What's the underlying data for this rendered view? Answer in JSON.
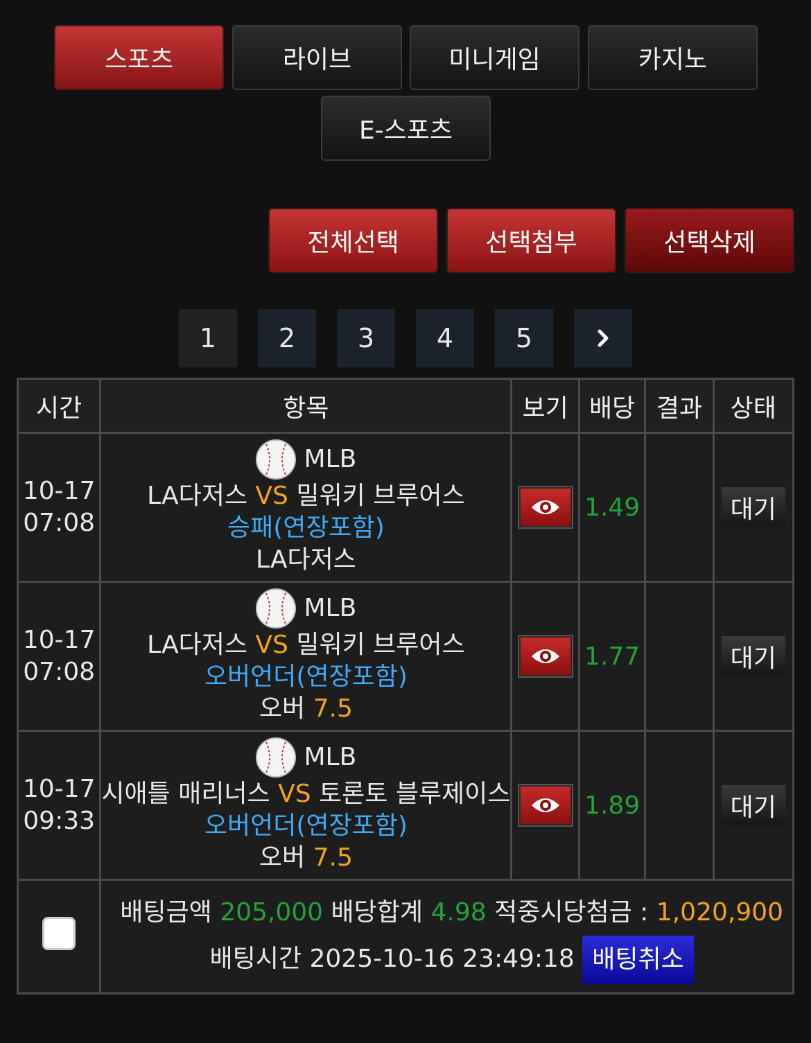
{
  "tabs": [
    {
      "label": "스포츠",
      "active": true
    },
    {
      "label": "라이브",
      "active": false
    },
    {
      "label": "미니게임",
      "active": false
    },
    {
      "label": "카지노",
      "active": false
    },
    {
      "label": "E-스포츠",
      "active": false
    }
  ],
  "actions": {
    "select_all": "전체선택",
    "attach_selected": "선택첨부",
    "delete_selected": "선택삭제"
  },
  "pagination": {
    "pages": [
      "1",
      "2",
      "3",
      "4",
      "5"
    ],
    "current": "1",
    "next_icon": "chevron-right-icon"
  },
  "table": {
    "headers": {
      "time": "시간",
      "item": "항목",
      "view": "보기",
      "odds": "배당",
      "result": "결과",
      "status": "상태"
    },
    "rows": [
      {
        "date": "10-17",
        "time": "07:08",
        "league": "MLB",
        "home": "LA다저스",
        "vs": "VS",
        "away": "밀워키 브루어스",
        "market": "승패(연장포함)",
        "pick": "LA다저스",
        "pick_value": "",
        "odds": "1.49",
        "result": "",
        "status": "대기"
      },
      {
        "date": "10-17",
        "time": "07:08",
        "league": "MLB",
        "home": "LA다저스",
        "vs": "VS",
        "away": "밀워키 브루어스",
        "market": "오버언더(연장포함)",
        "pick": "오버",
        "pick_value": "7.5",
        "odds": "1.77",
        "result": "",
        "status": "대기"
      },
      {
        "date": "10-17",
        "time": "09:33",
        "league": "MLB",
        "home": "시애틀 매리너스",
        "vs": "VS",
        "away": "토론토 블루제이스",
        "market": "오버언더(연장포함)",
        "pick": "오버",
        "pick_value": "7.5",
        "odds": "1.89",
        "result": "",
        "status": "대기"
      }
    ]
  },
  "summary": {
    "bet_amount_label": "배팅금액",
    "bet_amount": "205,000",
    "total_odds_label": "배당합계",
    "total_odds": "4.98",
    "payout_label": "적중시당첨금 :",
    "payout": "1,020,900",
    "bet_time_label": "배팅시간",
    "bet_time": "2025-10-16 23:49:18",
    "cancel_label": "배팅취소"
  },
  "colors": {
    "active_tab": "#b52a2a",
    "vs": "#f2a31a",
    "market": "#3fa9f5",
    "odds": "#22a33a",
    "cancel": "#1a1ac8"
  }
}
